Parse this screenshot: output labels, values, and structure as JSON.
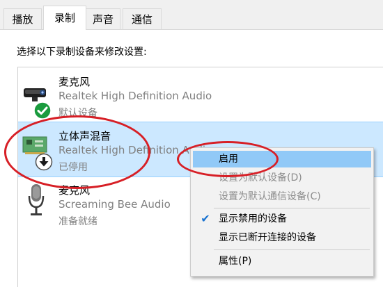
{
  "tabs": [
    {
      "label": "播放"
    },
    {
      "label": "录制"
    },
    {
      "label": "声音"
    },
    {
      "label": "通信"
    }
  ],
  "instruction": "选择以下录制设备来修改设置:",
  "devices": [
    {
      "name": "麦克风",
      "driver": "Realtek High Definition Audio",
      "status": "默认设备",
      "icon": "microphone-webcam-icon",
      "badge": "green-check-icon"
    },
    {
      "name": "立体声混音",
      "driver": "Realtek High Definition Audio",
      "status": "已停用",
      "icon": "sound-card-icon",
      "badge": "disabled-arrow-icon"
    },
    {
      "name": "麦克风",
      "driver": "Screaming Bee Audio",
      "status": "准备就绪",
      "icon": "microphone-icon"
    }
  ],
  "context_menu": {
    "items": [
      {
        "label": "启用",
        "state": "highlighted"
      },
      {
        "label": "设置为默认设备(D)",
        "state": "disabled"
      },
      {
        "label": "设置为默认通信设备(C)",
        "state": "disabled"
      },
      {
        "label": "显示禁用的设备",
        "state": "checked"
      },
      {
        "label": "显示已断开连接的设备",
        "state": "normal"
      },
      {
        "label": "属性(P)",
        "state": "normal"
      }
    ]
  },
  "colors": {
    "selection": "#cce8ff",
    "menu_highlight": "#91c9f7",
    "annotation": "#d71f26",
    "check": "#1a73d1"
  }
}
